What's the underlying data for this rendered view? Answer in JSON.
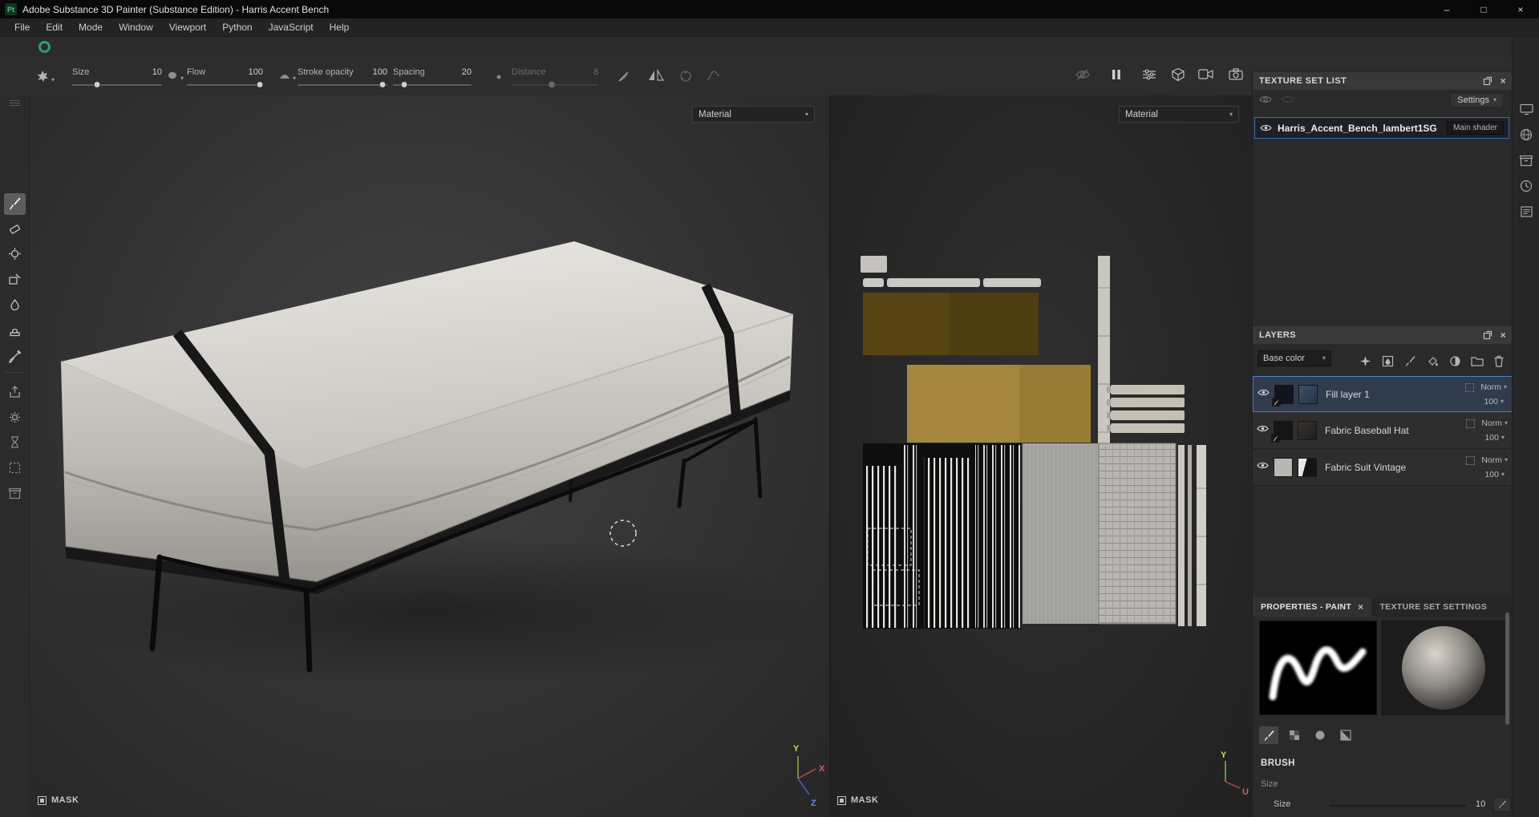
{
  "window": {
    "title": "Adobe Substance 3D Painter (Substance Edition) - Harris Accent Bench",
    "app_badge": "Pt"
  },
  "glyphs": {
    "chevron": "▾",
    "close": "×",
    "minimize": "–",
    "maximize": "□"
  },
  "menubar": [
    "File",
    "Edit",
    "Mode",
    "Window",
    "Viewport",
    "Python",
    "JavaScript",
    "Help"
  ],
  "toolbar": {
    "params": [
      {
        "label": "Size",
        "value": "10"
      },
      {
        "label": "Flow",
        "value": "100"
      },
      {
        "label": "Stroke opacity",
        "value": "100"
      },
      {
        "label": "Spacing",
        "value": "20"
      },
      {
        "label": "Distance",
        "value": "8"
      }
    ]
  },
  "viewport3d": {
    "shading_mode": "Material",
    "mask_label": "MASK",
    "axes": {
      "x": "X",
      "y": "Y",
      "z": "Z"
    }
  },
  "viewport2d": {
    "shading_mode": "Material",
    "mask_label": "MASK",
    "axes": {
      "y": "Y",
      "u": "U"
    }
  },
  "texture_set_list": {
    "title": "TEXTURE SET LIST",
    "settings_label": "Settings",
    "set_name": "Harris_Accent_Bench_lambert1SG",
    "shader_label": "Main shader"
  },
  "layers": {
    "title": "LAYERS",
    "channel": "Base color",
    "items": [
      {
        "name": "Fill layer 1",
        "blend": "Norm",
        "opacity": "100"
      },
      {
        "name": "Fabric Baseball Hat",
        "blend": "Norm",
        "opacity": "100"
      },
      {
        "name": "Fabric Suit Vintage",
        "blend": "Norm",
        "opacity": "100"
      }
    ]
  },
  "properties": {
    "tab_active": "PROPERTIES - PAINT",
    "tab_inactive": "TEXTURE SET SETTINGS",
    "section": "BRUSH",
    "param_group": "Size",
    "size_label": "Size",
    "size_value": "10"
  },
  "colors": {
    "accent_blue": "#4d82c4",
    "ring_green": "#2e9f6a"
  }
}
